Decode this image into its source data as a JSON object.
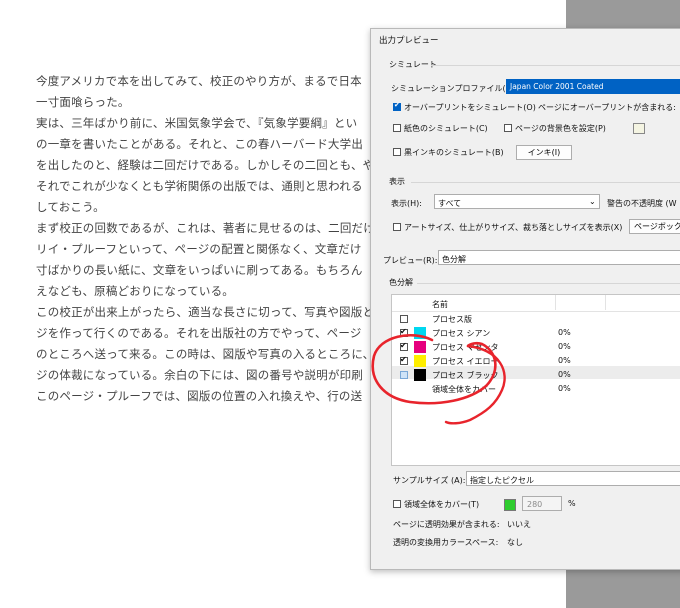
{
  "document": {
    "lines": [
      "今度アメリカで本を出してみて、校正のやり方が、まるで日本",
      "一寸面喰らった。",
      "実は、三年ばかり前に、米国気象学会で、『気象学要綱』とい",
      "の一章を書いたことがある。それと、この春ハーバード大学出",
      "を出したのと、経験は二回だけである。しかしその二回とも、や",
      "それでこれが少なくとも学術関係の出版では、通則と思われる",
      "しておこう。",
      "まず校正の回数であるが、これは、著者に見せるのは、二回だけ",
      "リイ・プルーフといって、ページの配置と関係なく、文章だけ",
      "寸ばかりの長い紙に、文章をいっぱいに刷ってある。もちろん",
      "えなども、原稿どおりになっている。",
      "この校正が出来上がったら、適当な長さに切って、写真や図版と",
      "ジを作って行くのである。それを出版社の方でやって、ページ",
      "のところへ送って来る。この時は、図版や写真の入るところに、",
      "ジの体裁になっている。余白の下には、図の番号や説明が印刷",
      "このページ・プルーフでは、図版の位置の入れ換えや、行の送"
    ]
  },
  "dialog": {
    "title": "出力プレビュー",
    "simulate": {
      "group_label": "シミュレート",
      "profile_label": "シミュレーションプロファイル(S):",
      "profile_value": "Japan Color 2001 Coated",
      "overprint_label": "オーバープリントをシミュレート(O)",
      "page_overprint_label": "ページにオーバープリントが含まれる:",
      "paper_color_label": "紙色のシミュレート(C)",
      "page_bg_label": "ページの背景色を設定(P)",
      "black_ink_label": "黒インキのシミュレート(B)",
      "ink_button": "インキ(I)"
    },
    "display": {
      "group_label": "表示",
      "show_label": "表示(H):",
      "show_value": "すべて",
      "warn_label": "警告の不透明度 (W",
      "artbox_label": "アートサイズ、仕上がりサイズ、裁ち落としサイズを表示(X)",
      "pagebox_button": "ページボックス"
    },
    "preview": {
      "label": "プレビュー(R):",
      "value": "色分解"
    },
    "separations": {
      "group_label": "色分解",
      "header_name": "名前",
      "rows": [
        {
          "name": "プロセス版",
          "percent": "",
          "checked": false,
          "color": ""
        },
        {
          "name": "プロセス シアン",
          "percent": "0%",
          "checked": true,
          "color": "#00d8f0"
        },
        {
          "name": "プロセス マゼンタ",
          "percent": "0%",
          "checked": true,
          "color": "#e6007e"
        },
        {
          "name": "プロセス イエロー",
          "percent": "0%",
          "checked": true,
          "color": "#ffee00"
        },
        {
          "name": "プロセス ブラック",
          "percent": "0%",
          "checked": false,
          "color": "#000000"
        },
        {
          "name": "領域全体をカバー",
          "percent": "0%",
          "checked": false,
          "color": ""
        }
      ]
    },
    "sample": {
      "label": "サンプルサイズ (A):",
      "value": "指定したピクセル"
    },
    "coverage": {
      "label": "領域全体をカバー(T)",
      "value": "280",
      "unit": "%"
    },
    "transparency_label": "ページに透明効果が含まれる:",
    "transparency_value": "いいえ",
    "blend_space_label": "透明の変換用カラースペース:",
    "blend_space_value": "なし"
  },
  "colors": {
    "accent": "#0062c4",
    "annotation": "#e8242c",
    "coverage_swatch": "#2ecc2e"
  }
}
